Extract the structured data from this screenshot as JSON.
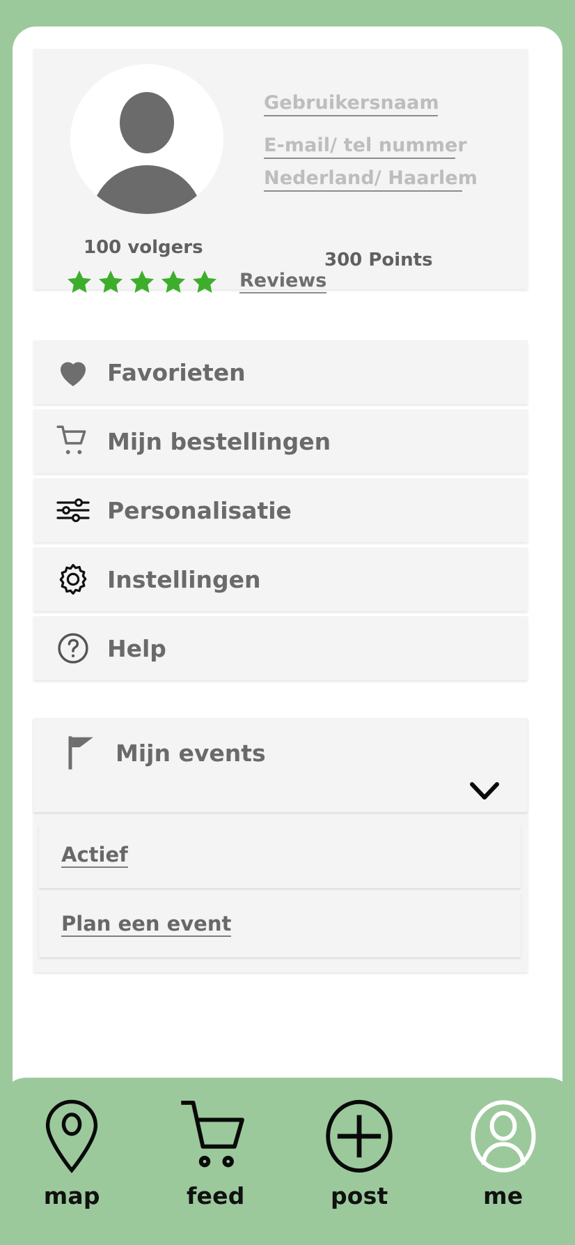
{
  "theme": {
    "brand_green": "#9BC99B",
    "card_bg": "#F4F4F4",
    "screen_bg": "#FFFFFF",
    "star_green": "#3DAE2B",
    "text_gray": "#6A6A6A",
    "placeholder_gray": "#BDBDBD"
  },
  "profile": {
    "avatar_icon": "user-avatar-icon",
    "username_placeholder": "Gebruikersnaam",
    "contact_placeholder": "E-mail/ tel nummer",
    "location_placeholder": "Nederland/ Haarlem",
    "followers": "100 volgers",
    "points": "300  Points",
    "rating": 5,
    "max_rating": 5,
    "reviews_label": "Reviews"
  },
  "menu": {
    "items": [
      {
        "id": "favorieten",
        "label": "Favorieten",
        "icon": "heart-icon"
      },
      {
        "id": "bestellingen",
        "label": "Mijn bestellingen",
        "icon": "shopping-cart-icon"
      },
      {
        "id": "personalisatie",
        "label": "Personalisatie",
        "icon": "sliders-icon"
      },
      {
        "id": "instellingen",
        "label": "Instellingen",
        "icon": "gear-icon"
      },
      {
        "id": "help",
        "label": "Help",
        "icon": "question-circle-icon"
      }
    ]
  },
  "events": {
    "header_label": "Mijn events",
    "header_icon": "flag-icon",
    "expand_icon": "chevron-down-icon",
    "sub_items": [
      {
        "id": "actief",
        "label": "Actief"
      },
      {
        "id": "plan",
        "label": "Plan een event"
      }
    ]
  },
  "bottom_nav": {
    "items": [
      {
        "id": "map",
        "label": "map",
        "icon": "map-pin-icon",
        "active": false
      },
      {
        "id": "feed",
        "label": "feed",
        "icon": "shopping-cart-icon",
        "active": false
      },
      {
        "id": "post",
        "label": "post",
        "icon": "plus-circle-icon",
        "active": false
      },
      {
        "id": "me",
        "label": "me",
        "icon": "user-circle-icon",
        "active": true
      }
    ]
  }
}
